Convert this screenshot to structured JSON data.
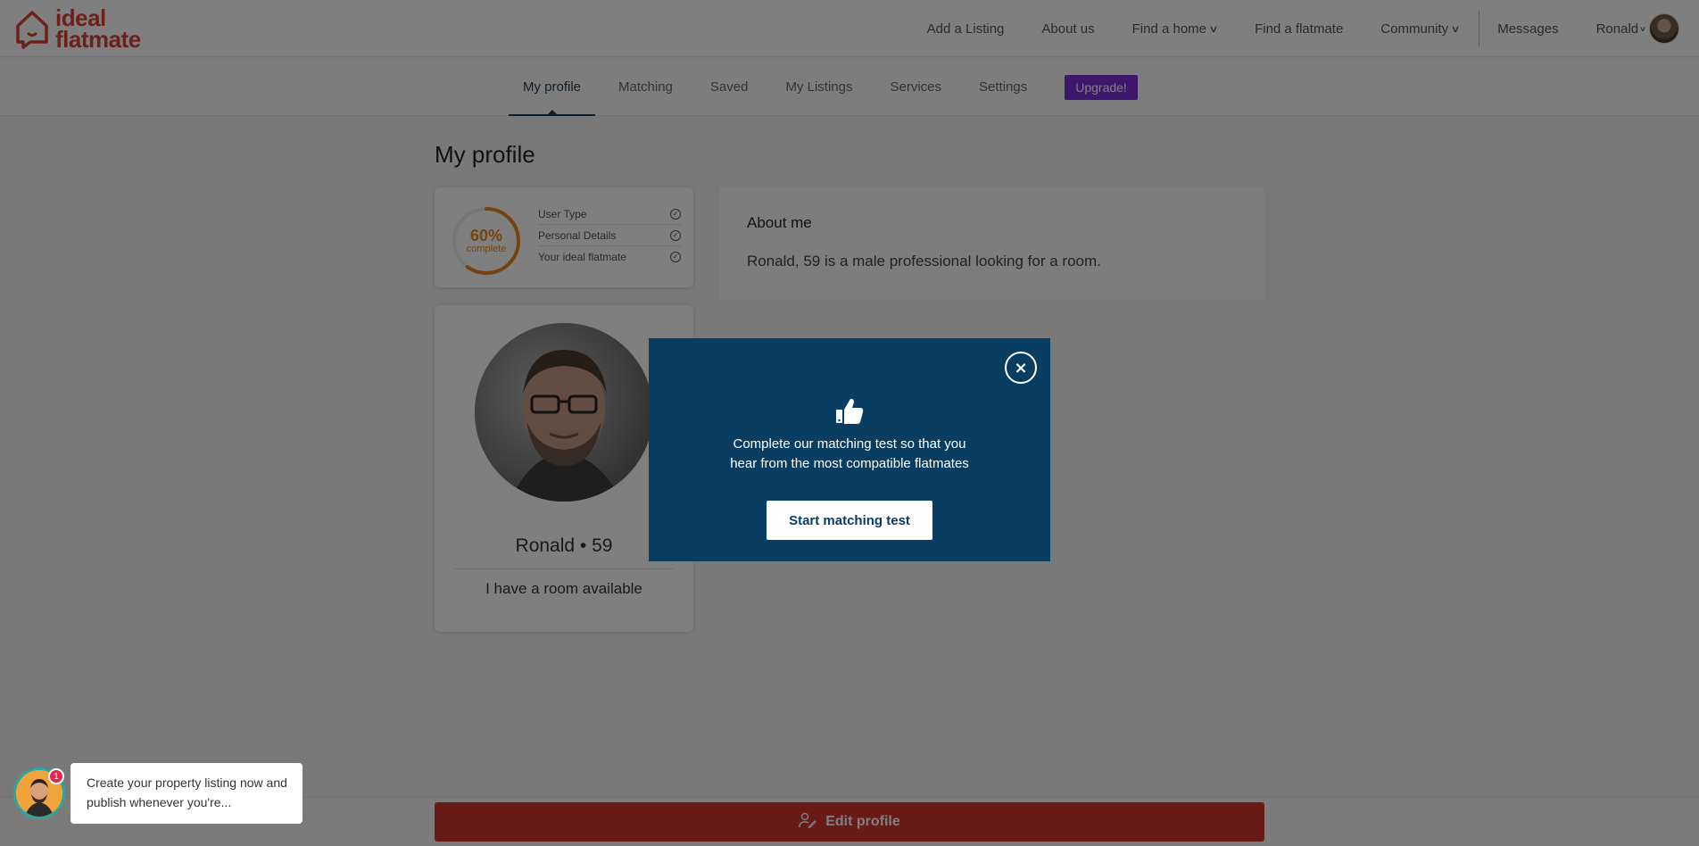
{
  "header": {
    "logo_line1": "ideal",
    "logo_line2": "flatmate",
    "nav": [
      {
        "label": "Add a Listing"
      },
      {
        "label": "About us"
      },
      {
        "label": "Find a home"
      },
      {
        "label": "Find a flatmate"
      },
      {
        "label": "Community"
      },
      {
        "label": "Messages"
      },
      {
        "label": "Ronald"
      }
    ]
  },
  "subnav": {
    "tabs": [
      {
        "label": "My profile"
      },
      {
        "label": "Matching"
      },
      {
        "label": "Saved"
      },
      {
        "label": "My Listings"
      },
      {
        "label": "Services"
      },
      {
        "label": "Settings"
      }
    ],
    "upgrade_label": "Upgrade!"
  },
  "main": {
    "page_title": "My profile",
    "progress": {
      "percent_label": "60%",
      "complete_label": "complete",
      "value": 0.6,
      "items": [
        {
          "label": "User Type"
        },
        {
          "label": "Personal Details"
        },
        {
          "label": "Your ideal flatmate"
        }
      ]
    },
    "about": {
      "title": "About me",
      "text": "Ronald, 59 is a male professional looking for a room."
    },
    "profile": {
      "name_age": "Ronald • 59",
      "status": "I have a room available"
    }
  },
  "footer": {
    "edit_label": "Edit profile"
  },
  "modal": {
    "close_symbol": "×",
    "text_line1": "Complete our matching test so that you",
    "text_line2": "hear from the most compatible flatmates",
    "button_label": "Start matching test"
  },
  "chat": {
    "badge_count": "1",
    "message_line1": "Create your property listing now and",
    "message_line2": "publish whenever you're..."
  },
  "colors": {
    "brand_red": "#d9423a",
    "modal_navy": "#0a3d62",
    "upgrade_purple": "#7b2fd6",
    "progress_orange": "#e8891d",
    "edit_button_red": "#d0352c"
  }
}
